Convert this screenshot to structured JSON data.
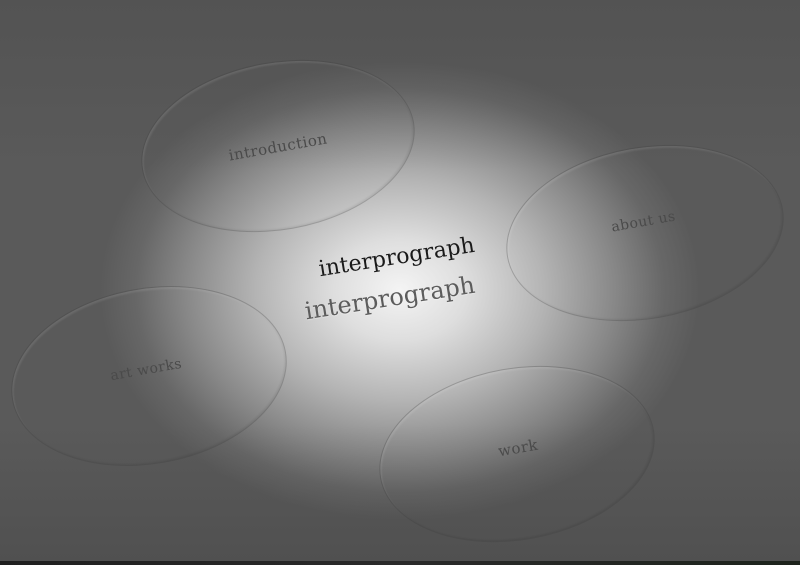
{
  "brand": {
    "title": "interprograph",
    "subtitle": "interprograph"
  },
  "nav": {
    "introduction": "introduction",
    "about_us": "about us",
    "art_works": "art works",
    "work": "work"
  }
}
